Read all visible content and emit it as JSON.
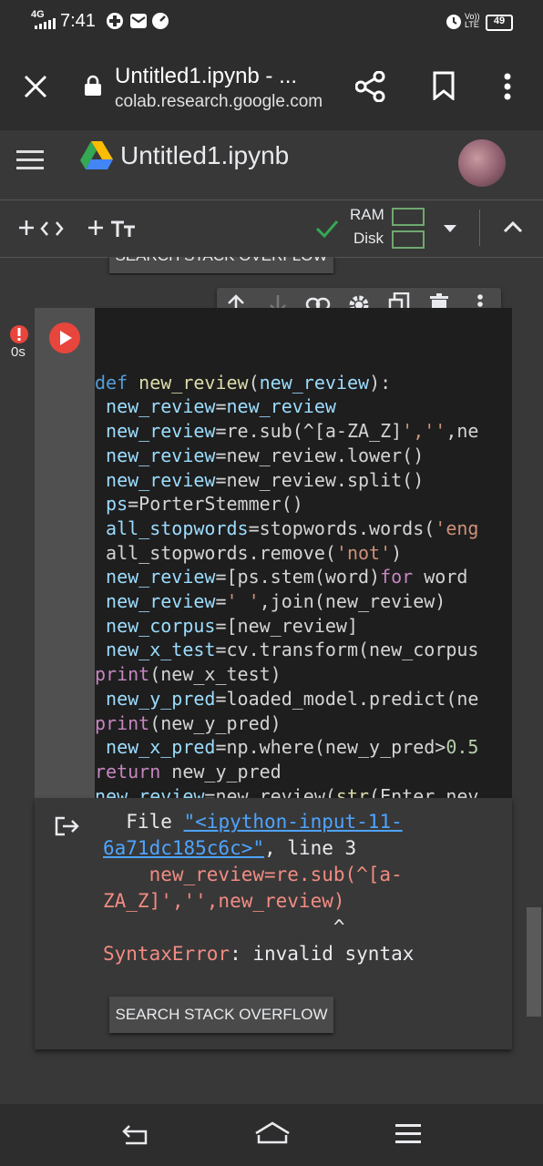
{
  "status_bar": {
    "network": "4G",
    "time": "7:41",
    "volte": "Vo)) LTE",
    "battery": "49"
  },
  "browser": {
    "page_title": "Untitled1.ipynb - ...",
    "url": "colab.research.google.com"
  },
  "colab": {
    "notebook_title": "Untitled1.ipynb"
  },
  "toolbar": {
    "ram_label": "RAM",
    "disk_label": "Disk"
  },
  "prev_output": {
    "search_button": "SEARCH STACK OVERFLOW"
  },
  "cell": {
    "exec_time": "0s",
    "code_lines": [
      "def new_review(new_review):",
      " new_review=new_review",
      " new_review=re.sub(^[a-ZA_Z]','',ne",
      " new_review=new_review.lower()",
      " new_review=new_review.split()",
      " ps=PorterStemmer()",
      " all_stopwords=stopwords.words('eng",
      " all_stopwords.remove('not')",
      " new_review=[ps.stem(word)for word ",
      " new_review=' ',join(new_review)",
      " new_corpus=[new_review]",
      " new_x_test=cv.transform(new_corpus",
      "print(new_x_test)",
      " new_y_pred=loaded_model.predict(ne",
      "print(new_y_pred)",
      " new_x_pred=np.where(new_y_pred>0.5",
      "return new_y_pred",
      "new_review=new_review(str(Enter nev"
    ]
  },
  "output": {
    "file_prefix": "  File ",
    "file_link_1": "\"<ipython-input-11-",
    "file_link_2": "6a71dc185c6c>\"",
    "line_suffix": ", line 3",
    "err_code_1": "    new_review=re.sub(^[a-",
    "err_code_2": "ZA_Z]','',new_review)",
    "caret": "                    ^",
    "error_type": "SyntaxError",
    "error_msg": ": invalid syntax",
    "search_button": "SEARCH STACK OVERFLOW"
  },
  "colors": {
    "accent_run": "#e8453c",
    "link": "#4ea4ff",
    "error_red": "#f28b82",
    "check_green": "#34a853"
  }
}
